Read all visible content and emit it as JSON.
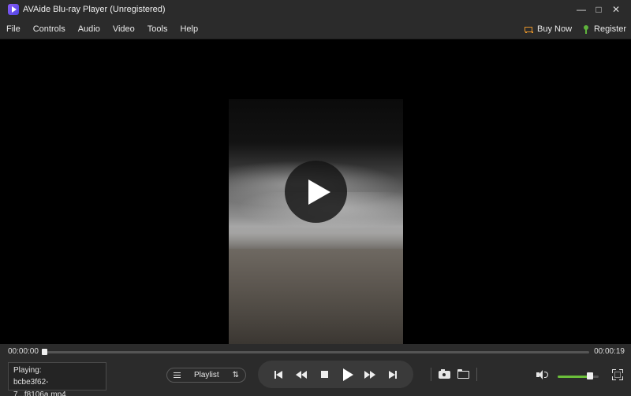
{
  "window": {
    "title": "AVAide Blu-ray Player (Unregistered)",
    "minimize_icon": "minimize-icon",
    "maximize_icon": "maximize-icon",
    "close_icon": "close-icon"
  },
  "menu": {
    "items": [
      {
        "label": "File"
      },
      {
        "label": "Controls"
      },
      {
        "label": "Audio"
      },
      {
        "label": "Video"
      },
      {
        "label": "Tools"
      },
      {
        "label": "Help"
      }
    ],
    "buy_now": {
      "label": "Buy Now",
      "icon": "cart-icon",
      "color": "#e3932b"
    },
    "register": {
      "label": "Register",
      "icon": "key-icon",
      "color": "#5fb33c"
    }
  },
  "player": {
    "overlay_icon": "play-icon",
    "time_current": "00:00:00",
    "time_total": "00:00:19",
    "progress_fraction": 0.0,
    "now_playing_label": "Playing:",
    "now_playing_file": "bcbe3f62-7...f8106a.mp4",
    "playlist_label": "Playlist",
    "volume_fraction": 0.8,
    "volume_color": "#6bbf3a"
  },
  "symbols": {
    "minimize": "—",
    "maximize": "□",
    "close": "✕",
    "sort": "⇅"
  }
}
